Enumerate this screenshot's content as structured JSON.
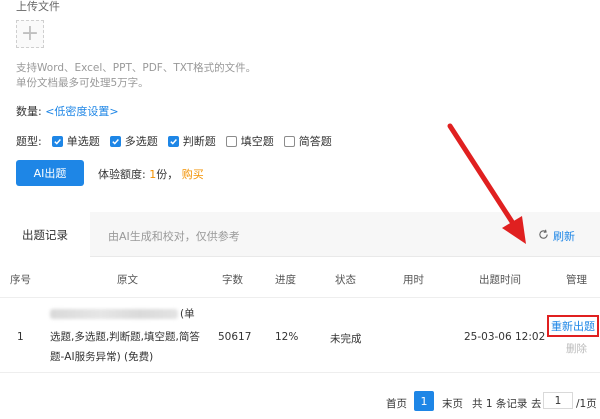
{
  "upload": {
    "title": "上传文件",
    "plus": "+",
    "hint1": "支持Word、Excel、PPT、PDF、TXT格式的文件。",
    "hint2": "单份文档最多可处理5万字。"
  },
  "quantity": {
    "label": "数量:",
    "value": "<低密度设置>"
  },
  "question_types": {
    "label": "题型:",
    "options": [
      {
        "label": "单选题",
        "checked": true
      },
      {
        "label": "多选题",
        "checked": true
      },
      {
        "label": "判断题",
        "checked": true
      },
      {
        "label": "填空题",
        "checked": false
      },
      {
        "label": "简答题",
        "checked": false
      }
    ]
  },
  "generate_button": "AI出题",
  "quota": {
    "prefix": "体验额度:",
    "count": "1",
    "unit": "份，",
    "buy": "购买"
  },
  "tabs": {
    "active": "出题记录",
    "hint": "由AI生成和校对，仅供参考",
    "refresh": "刷新"
  },
  "table": {
    "headers": [
      "序号",
      "原文",
      "字数",
      "进度",
      "状态",
      "用时",
      "出题时间",
      "管理"
    ],
    "rows": [
      {
        "index": "1",
        "text_suffix": "(单",
        "text_line2": "选题,多选题,判断题,填空题,简答",
        "text_line3": "题-AI服务异常)  (免费)",
        "words": "50617",
        "progress": "12%",
        "status": "未完成",
        "duration": "",
        "time": "25-03-06 12:02",
        "actions": {
          "redo": "重新出题",
          "delete": "删除"
        }
      }
    ]
  },
  "pagination": {
    "first": "首页",
    "current": "1",
    "last": "末页",
    "summary": "共 1 条记录",
    "goto": "去",
    "input_value": "1",
    "total_pages": "/1页"
  },
  "annotation": {
    "arrow_color": "#e02020",
    "highlight_color": "#e02020"
  },
  "colors": {
    "accent": "#1e86e6",
    "warning": "#f29100"
  }
}
